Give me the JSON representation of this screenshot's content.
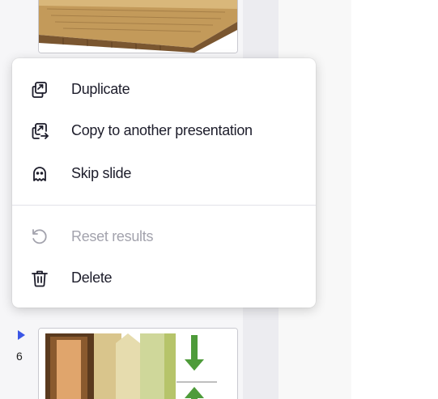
{
  "context_menu": {
    "items": [
      {
        "label": "Duplicate",
        "icon": "duplicate-icon",
        "enabled": true
      },
      {
        "label": "Copy to another presentation",
        "icon": "copy-to-presentation-icon",
        "enabled": true
      },
      {
        "label": "Skip slide",
        "icon": "ghost-icon",
        "enabled": true
      },
      {
        "label": "Reset results",
        "icon": "reset-icon",
        "enabled": false
      },
      {
        "label": "Delete",
        "icon": "trash-icon",
        "enabled": true
      }
    ]
  },
  "slides": {
    "current_number": "6"
  },
  "colors": {
    "accent": "#3b56e6",
    "text": "#1d1d2b",
    "disabled_text": "#a3a3ad"
  }
}
